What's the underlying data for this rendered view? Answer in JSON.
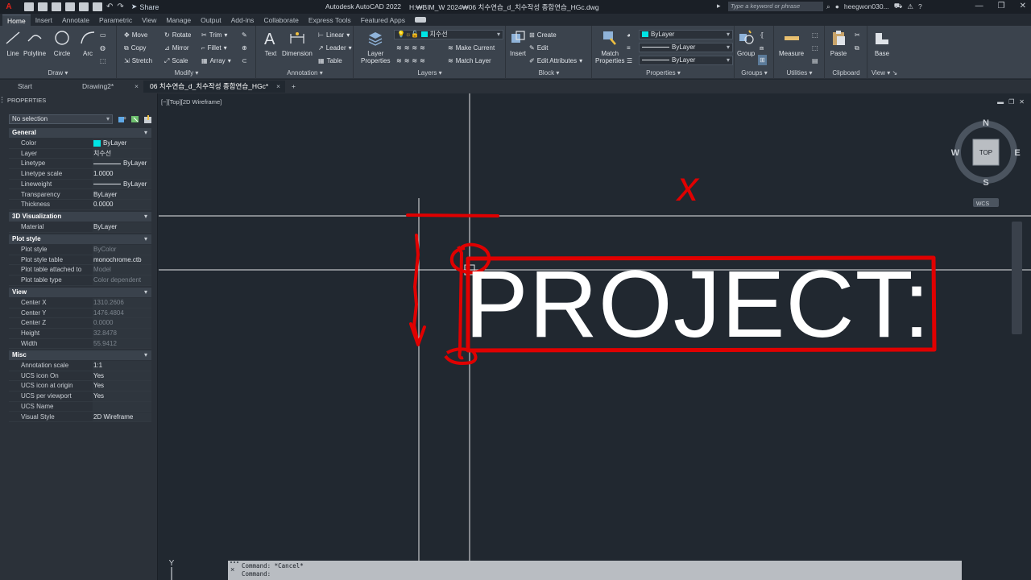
{
  "titlebar": {
    "logo": "A",
    "share": "Share",
    "app": "Autodesk AutoCAD 2022",
    "file": "H:₩BIM_W 2024₩06 치수연습_d_치수작성 종합연습_HGc.dwg",
    "search_placeholder": "Type a keyword or phrase",
    "user": "heegwon030...",
    "help": "?"
  },
  "ribbon_tabs": [
    "Home",
    "Insert",
    "Annotate",
    "Parametric",
    "View",
    "Manage",
    "Output",
    "Add-ins",
    "Collaborate",
    "Express Tools",
    "Featured Apps"
  ],
  "ribbon": {
    "draw": {
      "title": "Draw",
      "line": "Line",
      "polyline": "Polyline",
      "circle": "Circle",
      "arc": "Arc"
    },
    "modify": {
      "title": "Modify",
      "move": "Move",
      "rotate": "Rotate",
      "trim": "Trim",
      "copy": "Copy",
      "mirror": "Mirror",
      "fillet": "Fillet",
      "stretch": "Stretch",
      "scale": "Scale",
      "array": "Array"
    },
    "annotation": {
      "title": "Annotation",
      "text": "Text",
      "dimension": "Dimension",
      "linear": "Linear",
      "leader": "Leader",
      "table": "Table"
    },
    "layers": {
      "title": "Layers",
      "layer_properties": "Layer\nProperties",
      "current_layer": "치수선",
      "make_current": "Make Current",
      "match_layer": "Match Layer"
    },
    "block": {
      "title": "Block",
      "insert": "Insert",
      "create": "Create",
      "edit": "Edit",
      "edit_attributes": "Edit Attributes"
    },
    "properties": {
      "title": "Properties",
      "match_properties": "Match\nProperties",
      "color": "ByLayer",
      "linetype": "ByLayer",
      "lineweight": "ByLayer"
    },
    "groups": {
      "title": "Groups",
      "group": "Group"
    },
    "utilities": {
      "title": "Utilities",
      "measure": "Measure"
    },
    "clipboard": {
      "title": "Clipboard",
      "paste": "Paste"
    },
    "view": {
      "title": "View",
      "base": "Base"
    }
  },
  "doc_tabs": {
    "start": "Start",
    "drawing2": "Drawing2*",
    "active": "06 치수연습_d_치수작성 종합연습_HGc*",
    "close": "×",
    "add": "+"
  },
  "properties_palette": {
    "title": "PROPERTIES",
    "selection": "No selection",
    "sections": [
      {
        "name": "General",
        "rows": [
          {
            "k": "Color",
            "v": "ByLayer"
          },
          {
            "k": "Layer",
            "v": "치수선"
          },
          {
            "k": "Linetype",
            "v": "ByLayer"
          },
          {
            "k": "Linetype scale",
            "v": "1.0000"
          },
          {
            "k": "Lineweight",
            "v": "ByLayer"
          },
          {
            "k": "Transparency",
            "v": "ByLayer"
          },
          {
            "k": "Thickness",
            "v": "0.0000"
          }
        ]
      },
      {
        "name": "3D Visualization",
        "rows": [
          {
            "k": "Material",
            "v": "ByLayer"
          }
        ]
      },
      {
        "name": "Plot style",
        "rows": [
          {
            "k": "Plot style",
            "v": "ByColor"
          },
          {
            "k": "Plot style table",
            "v": "monochrome.ctb"
          },
          {
            "k": "Plot table attached to",
            "v": "Model"
          },
          {
            "k": "Plot table type",
            "v": "Color dependent"
          }
        ]
      },
      {
        "name": "View",
        "rows": [
          {
            "k": "Center X",
            "v": "1310.2606"
          },
          {
            "k": "Center Y",
            "v": "1476.4804"
          },
          {
            "k": "Center Z",
            "v": "0.0000"
          },
          {
            "k": "Height",
            "v": "32.8478"
          },
          {
            "k": "Width",
            "v": "55.9412"
          }
        ]
      },
      {
        "name": "Misc",
        "rows": [
          {
            "k": "Annotation scale",
            "v": "1:1"
          },
          {
            "k": "UCS icon On",
            "v": "Yes"
          },
          {
            "k": "UCS icon at origin",
            "v": "Yes"
          },
          {
            "k": "UCS per viewport",
            "v": "Yes"
          },
          {
            "k": "UCS Name",
            "v": ""
          },
          {
            "k": "Visual Style",
            "v": "2D Wireframe"
          }
        ]
      }
    ]
  },
  "viewport": {
    "label": "[−][Top][2D Wireframe]",
    "drawing_text": "PROJECT:",
    "annotation_mark": "x",
    "viewcube": {
      "n": "N",
      "s": "S",
      "e": "E",
      "w": "W",
      "face": "TOP",
      "ucs": "WCS"
    },
    "ucs_axis": "Y"
  },
  "command": {
    "line1": "Command: *Cancel*",
    "line2": "Command:",
    "close": "×"
  },
  "colors": {
    "accent_red": "#e00000",
    "layer_cyan": "#00e5e5",
    "background": "#212830"
  }
}
